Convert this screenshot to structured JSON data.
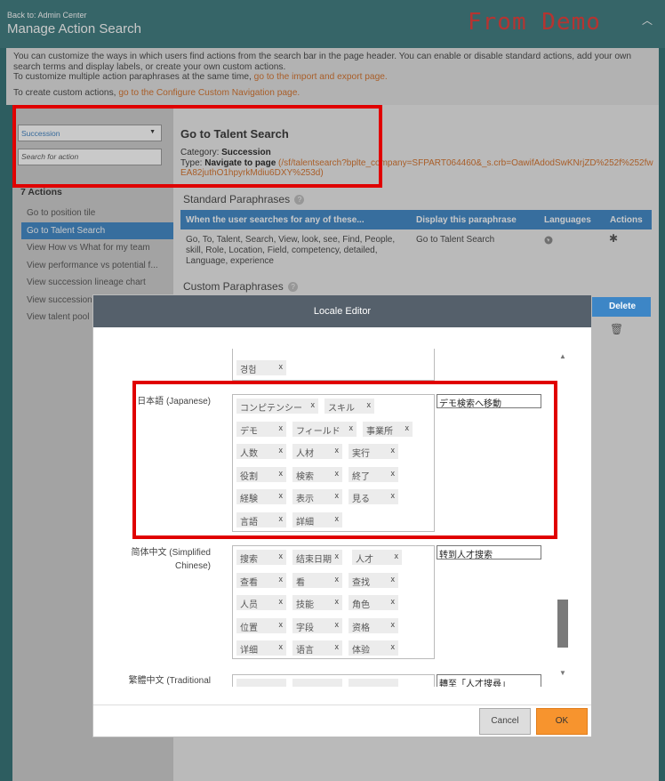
{
  "header": {
    "back_label": "Back to: Admin Center",
    "title": "Manage Action Search",
    "watermark": "From Demo",
    "collapse_icon": "chevron-up-icon"
  },
  "info": {
    "line1": "You can customize the ways in which users find actions from the search bar in the page header. You can enable or disable standard actions, add your own search terms and display labels, or create your own custom actions.",
    "line2_prefix": "To customize multiple action paraphrases at the same time, ",
    "line2_link": "go to the import and export page.",
    "line3_prefix": "To create custom actions, ",
    "line3_link": "go to the Configure Custom Navigation page."
  },
  "left": {
    "category_select": "Succession",
    "search_placeholder": "Search for action",
    "actions_count": "7 Actions",
    "actions": [
      "Go to position tile",
      "Go to Talent Search",
      "View How vs What for my team",
      "View performance vs potential f...",
      "View succession lineage chart",
      "View succession",
      "View talent pool"
    ],
    "active_index": 1
  },
  "detail": {
    "title": "Go to Talent Search",
    "category_label": "Category: ",
    "category_value": "Succession",
    "type_label": "Type: ",
    "type_value": "Navigate to page",
    "type_link_open": " (",
    "type_link": "/sf/talentsearch?bplte_company=SFPART064460&_s.crb=OawifAdodSwKNrjZD%252f%252fwEA82juthO1hpyrkMdiu6DXY%253d",
    "type_link_close": ")",
    "standard_title": "Standard Paraphrases",
    "custom_title": "Custom Paraphrases",
    "columns": [
      "When the user searches for any of these...",
      "Display this paraphrase",
      "Languages",
      "Actions"
    ],
    "row": {
      "terms": "Go, To, Talent, Search, View, look, see, Find, People, skill, Role, Location, Field, competency, detailed, Language, experience",
      "display": "Go to Talent Search",
      "languages_icon": "globe-icon",
      "actions_icon": "gear-icon"
    }
  },
  "modal": {
    "title": "Locale Editor",
    "delete_label": "Delete",
    "cancel_label": "Cancel",
    "ok_label": "OK",
    "korean_tail_tag": "경험",
    "japanese": {
      "label": "日本語 (Japanese)",
      "tags": [
        "コンピテンシー",
        "スキル",
        "デモ",
        "フィールド",
        "事業所",
        "人数",
        "人材",
        "実行",
        "役割",
        "検索",
        "終了",
        "経験",
        "表示",
        "見る",
        "言語",
        "詳細"
      ],
      "value": "デモ検索へ移動"
    },
    "chinese_simplified": {
      "label": "简体中文 (Simplified Chinese)",
      "tags": [
        "搜索",
        "结束日期",
        "人才",
        "查看",
        "看",
        "查找",
        "人员",
        "技能",
        "角色",
        "位置",
        "字段",
        "资格",
        "详细",
        "语言",
        "体验"
      ],
      "value": "转到人才搜索"
    },
    "chinese_traditional": {
      "label": "繁體中文 (Traditional",
      "value": "轉至「人才搜尋」"
    }
  }
}
